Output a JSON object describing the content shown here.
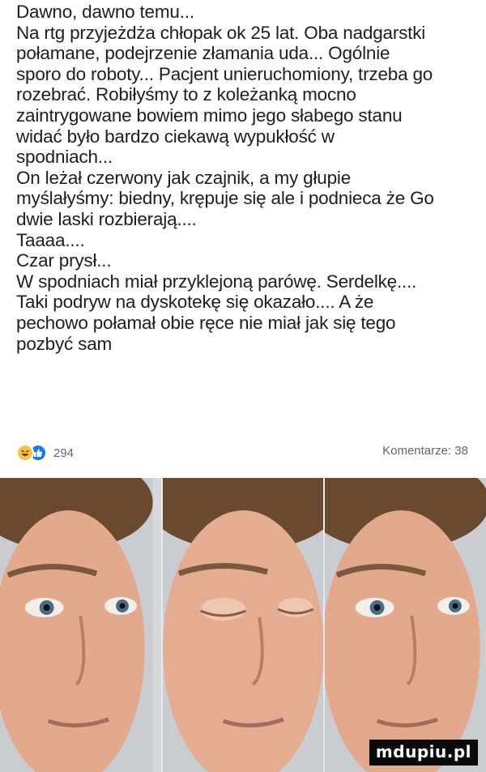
{
  "post": {
    "lines": [
      "Dawno, dawno temu...",
      "Na rtg przyjeżdża chłopak ok 25 lat. Oba nadgarstki",
      "połamane, podejrzenie złamania uda... Ogólnie",
      "sporo do roboty... Pacjent unieruchomiony, trzeba go",
      "rozebrać. Robiłyśmy to z koleżanką mocno",
      "zaintrygowane bowiem mimo jego słabego stanu",
      "widać było bardzo ciekawą wypukłość w",
      "spodniach...",
      "On leżał czerwony jak czajnik, a my głupie",
      "myślałyśmy: biedny, krępuje się ale i podnieca że Go",
      "dwie laski rozbierają....",
      "Taaaa....",
      "Czar prysł...",
      "W spodniach miał przyklejoną parówę. Serdelkę....",
      "Taki podryw na dyskotekę się okazało.... A że",
      "pechowo połamał obie ręce nie miał jak się tego",
      "pozbyć sam"
    ],
    "reaction_count": "294",
    "comments_label": "Komentarze: 38"
  },
  "icons": {
    "haha": "haha-reaction-icon",
    "like": "like-reaction-icon"
  },
  "colors": {
    "text": "#1c1e21",
    "meta": "#65676b",
    "like": "#1877f2",
    "haha": "#f7c244"
  },
  "meme": {
    "panels": [
      "eyes-open",
      "eyes-closed",
      "eyes-open"
    ]
  },
  "watermark": "mdupiu.pl"
}
